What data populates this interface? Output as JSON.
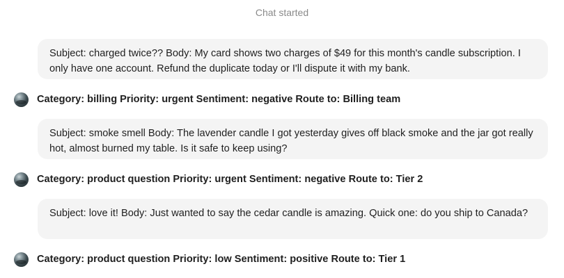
{
  "header": {
    "status": "Chat started"
  },
  "messages": [
    {
      "role": "user",
      "text": "Subject: charged twice?? Body: My card shows two charges of $49 for this month's candle subscription. I only have one account. Refund the duplicate today or I'll dispute it with my bank."
    },
    {
      "role": "assistant",
      "text": "Category: billing Priority: urgent Sentiment: negative Route to: Billing team",
      "avatar_icon": "bot-avatar-icon"
    },
    {
      "role": "user",
      "text": "Subject: smoke smell Body: The lavender candle I got yesterday gives off black smoke and the jar got really hot, almost burned my table. Is it safe to keep using?"
    },
    {
      "role": "assistant",
      "text": "Category: product question Priority: urgent Sentiment: negative Route to: Tier 2",
      "avatar_icon": "bot-avatar-icon"
    },
    {
      "role": "user",
      "text": "Subject: love it! Body: Just wanted to say the cedar candle is amazing. Quick one: do you ship to Canada?"
    },
    {
      "role": "assistant",
      "text": "Category: product question Priority: low Sentiment: positive Route to: Tier 1",
      "avatar_icon": "bot-avatar-icon"
    }
  ],
  "colors": {
    "background": "#ffffff",
    "user_bubble": "#f4f4f4",
    "text": "#1f1f1f",
    "muted": "#8a8a8a"
  }
}
